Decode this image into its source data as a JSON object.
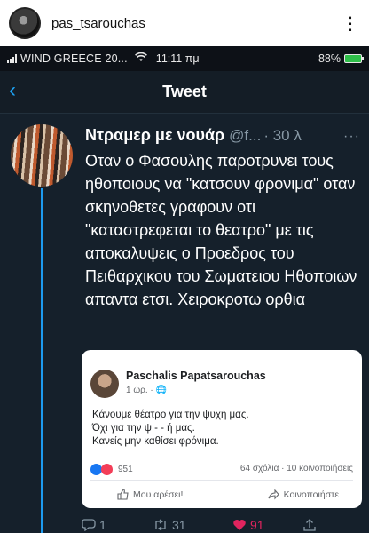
{
  "instagram": {
    "username": "pas_tsarouchas",
    "more": "⋮"
  },
  "status_bar": {
    "carrier": "WIND GREECE 20...",
    "time": "11:11 πμ",
    "battery": "88%",
    "battery_color": "#2fbf4a"
  },
  "nav": {
    "back": "‹",
    "title": "Tweet"
  },
  "tweet": {
    "name": "Ντραμερ με νουάρ",
    "handle": "@f...",
    "time": "· 30 λ",
    "more": "···",
    "text": "Οταν ο Φασουλης παροτρυνει τους ηθοποιους να \"κατσουν φρονιμα\" οταν σκηνοθετες γραφουν οτι \"καταστρεφεται το θεατρο\" με τις αποκαλυψεις  ο Προεδρος του Πειθαρχικου του Σωματειου Ηθοποιων απαντα ετσι. Χειροκροτω ορθια",
    "accent_color": "#1d9bf0"
  },
  "facebook_post": {
    "author": "Paschalis Papatsarouchas",
    "meta": "1 ώρ. · 🌐",
    "lines": [
      "Κάνουμε θέατρο για την ψυχή μας.",
      "Όχι για την ψ - - ή μας.",
      "Κανείς μην καθίσει φρόνιμα."
    ],
    "reactions_count": "951",
    "counts": "64 σχόλια · 10 κοινοποιήσεις",
    "like_label": "Μου αρέσει!",
    "share_label": "Κοινοποιήστε"
  },
  "actions": {
    "replies": "1",
    "retweets": "31",
    "likes": "91"
  }
}
